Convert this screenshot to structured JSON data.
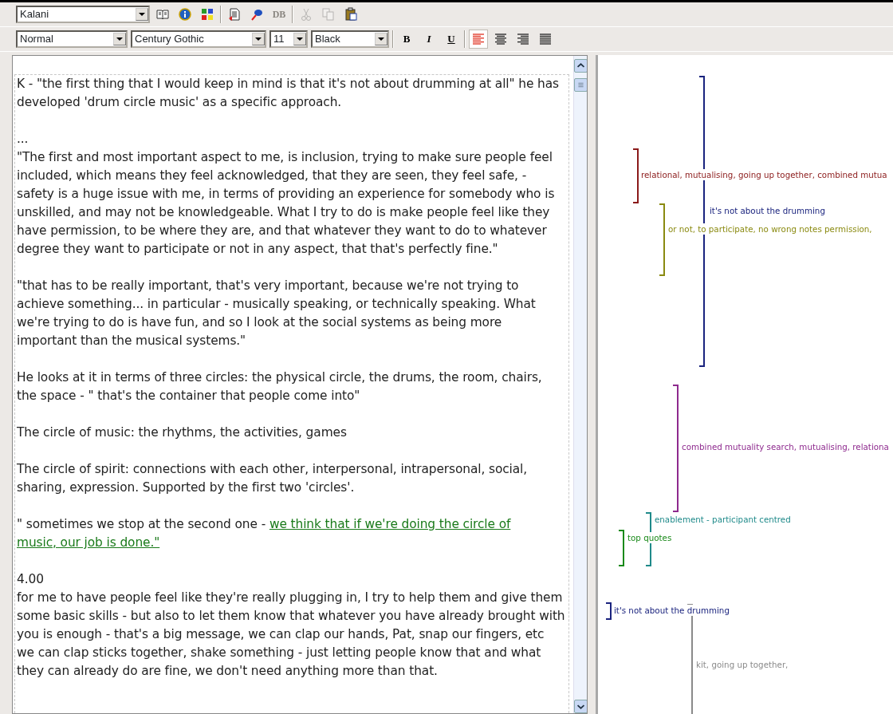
{
  "toolbar_top": {
    "combo": "Kalani",
    "buttons": [
      {
        "disabled": false
      },
      {
        "disabled": false
      },
      {
        "disabled": false
      },
      {
        "disabled": false
      },
      {
        "disabled": false
      },
      {
        "label": "DB",
        "disabled": true
      },
      {
        "disabled": true
      },
      {
        "disabled": true
      },
      {
        "disabled": false
      }
    ]
  },
  "toolbar_format": {
    "style": "Normal",
    "font": "Century Gothic",
    "size": "11",
    "text_color_name": "Black",
    "format_buttons": [
      {
        "label": "B",
        "selected": false
      },
      {
        "label": "I",
        "selected": false
      },
      {
        "label": "U",
        "selected": false
      }
    ],
    "align_buttons": [
      {
        "selected": true
      },
      {
        "selected": false
      },
      {
        "selected": false
      },
      {
        "selected": false
      }
    ]
  },
  "document": {
    "blocks": [
      [
        {
          "text": "K - \"the first thing that I would keep in mind is that it's not about drumming at all\" he has developed 'drum circle music' as a specific approach."
        }
      ],
      [
        {
          "text": "..."
        },
        {
          "text": "\"The first and most important aspect to me, is inclusion, trying to make sure people feel included, which means they feel acknowledged, that they are seen, they feel safe,  - safety is a huge issue with me, in terms of providing an experience for somebody who is unskilled, and may not be knowledgeable. What I try to do is make people feel like they have permission, to be where they are, and that whatever they want to do to whatever degree they want to participate or not in any aspect, that that's perfectly fine.\""
        }
      ],
      [
        {
          "text": "\"that has to be really important, that's very important, because we're not trying to achieve something... in particular - musically speaking, or technically speaking. What we're trying to do is have fun, and so I look at the social systems as being more important than the musical systems.\""
        }
      ],
      [
        {
          "text": "He looks at it in terms of three circles: the physical circle, the drums, the room, chairs, the space - \" that's the container that people come into\""
        }
      ],
      [
        {
          "text": "The circle of music: the rhythms, the activities, games"
        }
      ],
      [
        {
          "text": "The circle of spirit: connections with each other, interpersonal, intrapersonal, social, sharing, expression. Supported by the first two 'circles'."
        }
      ],
      [
        {
          "text": "\" sometimes we stop at the second one - ",
          "link": [
            "we think that if we're doing the circle of",
            "music, our job is done.\""
          ]
        }
      ],
      [
        {
          "text": "4.00"
        },
        {
          "text": "for me to have people feel like they're really plugging in, I try to help them and give them some basic skills - but also to let them know that whatever you have already brought with you is enough - that's a big message, we can clap our hands, Pat, snap our fingers, etc we can clap sticks together, shake something - just letting people know that and what they can already do are fine, we don't need anything more than that."
        }
      ]
    ]
  },
  "coding_stripes": [
    {
      "label": "relational, mutualising, going up together, combined mutua",
      "color": "#8b1a1a"
    },
    {
      "label": "it's not about the drumming",
      "color": "#1a237e"
    },
    {
      "label": "or not, to participate, no wrong notes permission,",
      "color": "#8a8a10"
    },
    {
      "label": "combined mutuality search, mutualising, relationa",
      "color": "#8e2a8e"
    },
    {
      "label": "enablement - participant centred",
      "color": "#1f8a8a"
    },
    {
      "label": "top quotes",
      "color": "#1a8a1a"
    },
    {
      "label": "it's not about the drumming",
      "color": "#1a237e"
    },
    {
      "label": "kit, going up together,",
      "color": "#8a8a8a"
    }
  ]
}
